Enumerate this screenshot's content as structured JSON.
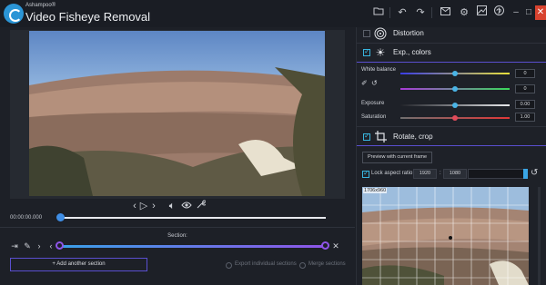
{
  "app": {
    "brand": "Ashampoo®",
    "title": "Video Fisheye Removal",
    "colors": {
      "accent": "#3f8ee6",
      "purple": "#8f55e8",
      "close": "#d8432f"
    }
  },
  "toolbar": {
    "icons": [
      "folder-icon",
      "undo-icon",
      "redo-icon",
      "mail-icon",
      "gear-icon",
      "chart-icon",
      "help-icon",
      "info-icon"
    ],
    "window_buttons": [
      "minimize-icon",
      "maximize-icon",
      "close-icon"
    ]
  },
  "player": {
    "timecode": "00:00:00.000",
    "seek_progress": 0.0,
    "controls": [
      "prev-frame-icon",
      "play-icon",
      "next-frame-icon",
      "volume-icon",
      "eye-icon",
      "wrench-icon"
    ]
  },
  "sections": {
    "label": "Section:",
    "add_button": "Add another section",
    "export_individual": "Export individual sections",
    "merge": "Merge sections",
    "range": [
      0.0,
      1.0
    ]
  },
  "panel": {
    "distortion": {
      "label": "Distortion",
      "checked": false
    },
    "exp_colors": {
      "label": "Exp., colors",
      "checked": true,
      "white_balance_label": "White balance",
      "white_balance_values": [
        "0",
        "0"
      ],
      "exposure_label": "Exposure",
      "exposure_value": "0.00",
      "saturation_label": "Saturation",
      "saturation_value": "1.00",
      "white_balance_levels": [
        0.5,
        0.5
      ],
      "exposure_level": 0.5,
      "saturation_level": 0.5
    },
    "rotate_crop": {
      "label": "Rotate, crop",
      "checked": true,
      "preview_button": "Preview with current frame",
      "lock_label": "Lock aspect ratio",
      "lock_checked": true,
      "width": "1920",
      "separator": ":",
      "height": "1080",
      "crop_dims": "1706x960"
    }
  }
}
